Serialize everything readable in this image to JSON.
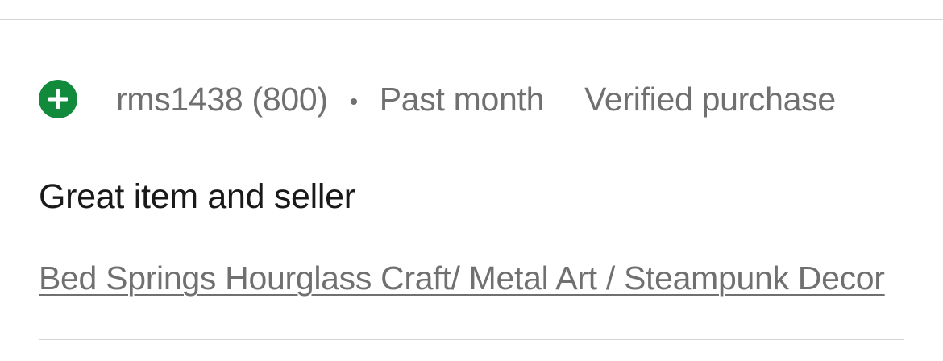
{
  "review": {
    "feedback_icon": "plus-circle-icon",
    "feedback_color": "#118a3c",
    "username": "rms1438 (800)",
    "separator": "•",
    "period": "Past month",
    "verified": "Verified purchase",
    "title": "Great item and seller",
    "item_link": "Bed Springs Hourglass Craft/ Metal Art / Steampunk Decor"
  }
}
